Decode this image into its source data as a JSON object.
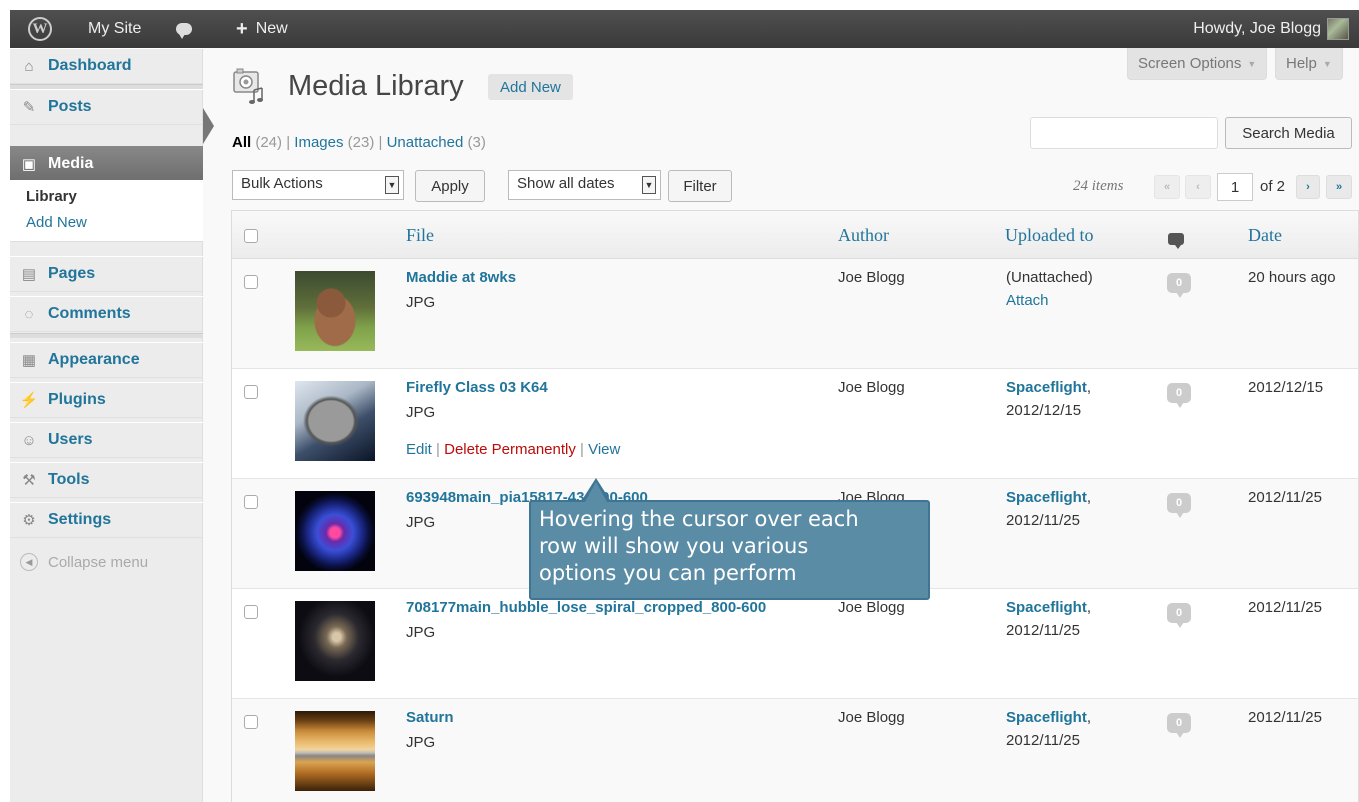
{
  "adminbar": {
    "site_name": "My Site",
    "new_label": "New",
    "howdy": "Howdy, Joe Blogg"
  },
  "sidebar": {
    "items": [
      {
        "label": "Dashboard",
        "icon": "dashboard-icon"
      },
      {
        "label": "Posts",
        "icon": "pin-icon"
      },
      {
        "label": "Media",
        "icon": "media-icon"
      },
      {
        "label": "Pages",
        "icon": "pages-icon"
      },
      {
        "label": "Comments",
        "icon": "comment-icon"
      },
      {
        "label": "Appearance",
        "icon": "appearance-icon"
      },
      {
        "label": "Plugins",
        "icon": "plug-icon"
      },
      {
        "label": "Users",
        "icon": "users-icon"
      },
      {
        "label": "Tools",
        "icon": "tools-icon"
      },
      {
        "label": "Settings",
        "icon": "settings-icon"
      }
    ],
    "submenu": {
      "library": "Library",
      "add_new": "Add New"
    },
    "collapse": "Collapse menu"
  },
  "header": {
    "title": "Media Library",
    "add_new": "Add New",
    "screen_options": "Screen Options",
    "help": "Help"
  },
  "filters": {
    "all": "All",
    "all_count": "(24)",
    "images": "Images",
    "images_count": "(23)",
    "unattached": "Unattached",
    "unattached_count": "(3)",
    "sep": "|"
  },
  "search": {
    "button": "Search Media",
    "value": ""
  },
  "tablenav": {
    "bulk_actions": "Bulk Actions",
    "apply": "Apply",
    "dates": "Show all dates",
    "filter": "Filter",
    "items": "24 items",
    "first": "«",
    "prev": "‹",
    "current_page": "1",
    "of": "of 2",
    "next": "›",
    "last": "»"
  },
  "table": {
    "columns": {
      "file": "File",
      "author": "Author",
      "uploaded_to": "Uploaded to",
      "date": "Date"
    },
    "rows": [
      {
        "title": "Maddie at 8wks",
        "type": "JPG",
        "author": "Joe Blogg",
        "uploaded_to": "(Unattached)",
        "uploaded_line2": "Attach",
        "comments": "0",
        "date": "20 hours ago"
      },
      {
        "title": "Firefly Class 03 K64",
        "type": "JPG",
        "author": "Joe Blogg",
        "uploaded_to": "Spaceflight",
        "uploaded_line2": "2012/12/15",
        "comments": "0",
        "date": "2012/12/15"
      },
      {
        "title": "693948main_pia15817-43_800-600",
        "type": "JPG",
        "author": "Joe Blogg",
        "uploaded_to": "Spaceflight",
        "uploaded_line2": "2012/11/25",
        "comments": "0",
        "date": "2012/11/25"
      },
      {
        "title": "708177main_hubble_lose_spiral_cropped_800-600",
        "type": "JPG",
        "author": "Joe Blogg",
        "uploaded_to": "Spaceflight",
        "uploaded_line2": "2012/11/25",
        "comments": "0",
        "date": "2012/11/25"
      },
      {
        "title": "Saturn",
        "type": "JPG",
        "author": "Joe Blogg",
        "uploaded_to": "Spaceflight",
        "uploaded_line2": "2012/11/25",
        "comments": "0",
        "date": "2012/11/25"
      }
    ],
    "row_actions": {
      "edit": "Edit",
      "delete": "Delete Permanently",
      "view": "View",
      "sep": "|"
    },
    "comma": ","
  },
  "callout": {
    "line1": "Hovering the cursor over each",
    "line2": "row will show you various",
    "line3": "options you can perform"
  }
}
